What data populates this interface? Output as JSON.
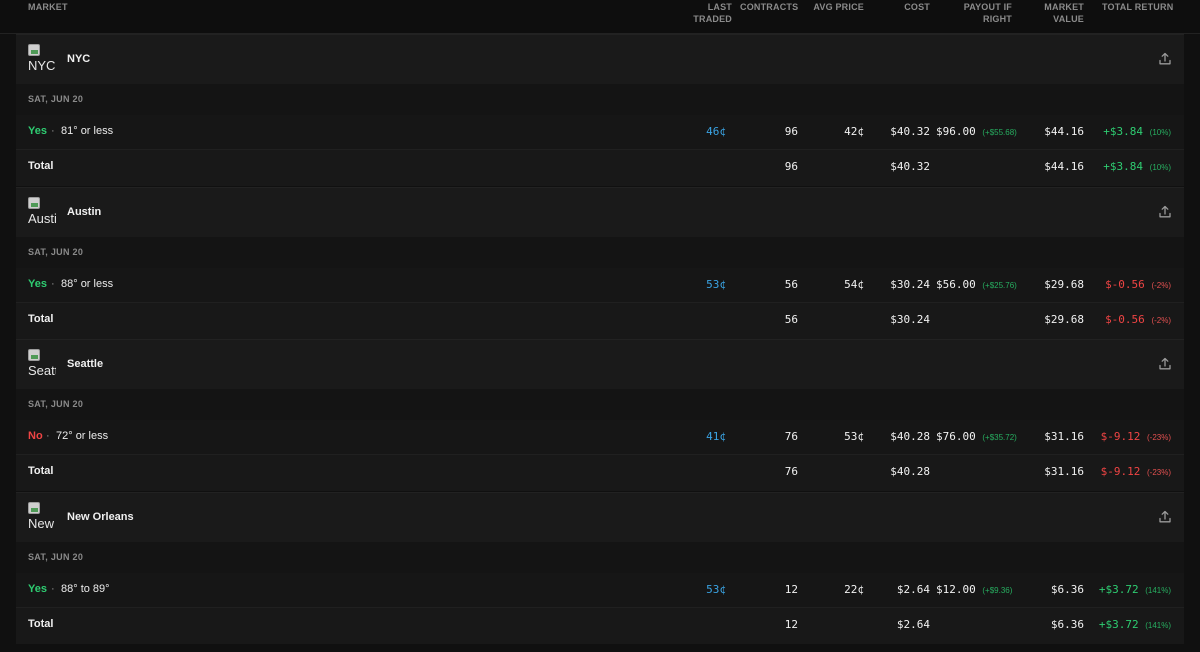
{
  "columns": {
    "market": "MARKET",
    "last_traded": "LAST TRADED",
    "contracts": "CONTRACTS",
    "avg_price": "AVG PRICE",
    "cost": "COST",
    "payout": "PAYOUT IF RIGHT",
    "market_value": "MARKET VALUE",
    "total_return": "TOTAL RETURN"
  },
  "colors": {
    "yes": "#2ecc71",
    "no": "#ef4444",
    "last_traded": "#3aa3e3",
    "background": "#101010"
  },
  "icons": {
    "share": "share-upload-icon",
    "thumbnail": "broken-image-icon"
  },
  "markets": [
    {
      "name": "NYC",
      "thumb_alt": "NYC",
      "date": "SAT, JUN 20",
      "position": {
        "side": "Yes",
        "dot": "·",
        "outcome": "81° or less",
        "last_traded": "46¢",
        "contracts": "96",
        "avg_price": "42¢",
        "cost": "$40.32",
        "payout": "$96.00",
        "payout_gain": "(+$55.68)",
        "market_value": "$44.16",
        "return": "+$3.84",
        "return_pct": "(10%)"
      },
      "total": {
        "label": "Total",
        "contracts": "96",
        "cost": "$40.32",
        "market_value": "$44.16",
        "return": "+$3.84",
        "return_pct": "(10%)"
      }
    },
    {
      "name": "Austin",
      "thumb_alt": "Austin",
      "date": "SAT, JUN 20",
      "position": {
        "side": "Yes",
        "dot": "·",
        "outcome": "88° or less",
        "last_traded": "53¢",
        "contracts": "56",
        "avg_price": "54¢",
        "cost": "$30.24",
        "payout": "$56.00",
        "payout_gain": "(+$25.76)",
        "market_value": "$29.68",
        "return": "$-0.56",
        "return_pct": "(-2%)"
      },
      "total": {
        "label": "Total",
        "contracts": "56",
        "cost": "$30.24",
        "market_value": "$29.68",
        "return": "$-0.56",
        "return_pct": "(-2%)"
      }
    },
    {
      "name": "Seattle",
      "thumb_alt": "Seattle",
      "date": "SAT, JUN 20",
      "position": {
        "side": "No",
        "dot": "·",
        "outcome": "72° or less",
        "last_traded": "41¢",
        "contracts": "76",
        "avg_price": "53¢",
        "cost": "$40.28",
        "payout": "$76.00",
        "payout_gain": "(+$35.72)",
        "market_value": "$31.16",
        "return": "$-9.12",
        "return_pct": "(-23%)"
      },
      "total": {
        "label": "Total",
        "contracts": "76",
        "cost": "$40.28",
        "market_value": "$31.16",
        "return": "$-9.12",
        "return_pct": "(-23%)"
      }
    },
    {
      "name": "New Orleans",
      "thumb_alt": "New Orleans",
      "date": "SAT, JUN 20",
      "position": {
        "side": "Yes",
        "dot": "·",
        "outcome": "88° to 89°",
        "last_traded": "53¢",
        "contracts": "12",
        "avg_price": "22¢",
        "cost": "$2.64",
        "payout": "$12.00",
        "payout_gain": "(+$9.36)",
        "market_value": "$6.36",
        "return": "+$3.72",
        "return_pct": "(141%)"
      },
      "total": {
        "label": "Total",
        "contracts": "12",
        "cost": "$2.64",
        "market_value": "$6.36",
        "return": "+$3.72",
        "return_pct": "(141%)"
      }
    }
  ]
}
